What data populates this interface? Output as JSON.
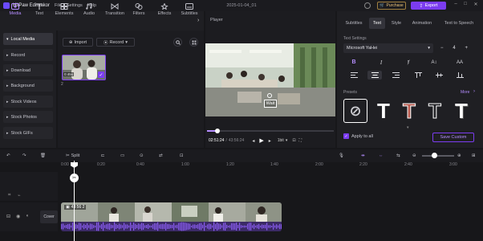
{
  "app": {
    "name": "HitPaw Edimakor",
    "menu": [
      "File",
      "Settings",
      "Help"
    ],
    "project_title": "2025-01-04_01",
    "purchase_label": "Purchase",
    "export_label": "Export"
  },
  "toolbar": {
    "tabs": [
      {
        "label": "Media",
        "icon": "media-icon"
      },
      {
        "label": "Text",
        "icon": "text-icon"
      },
      {
        "label": "Elements",
        "icon": "elements-icon"
      },
      {
        "label": "Audio",
        "icon": "audio-icon"
      },
      {
        "label": "Transition",
        "icon": "transition-icon"
      },
      {
        "label": "Filters",
        "icon": "filters-icon"
      },
      {
        "label": "Effects",
        "icon": "effects-icon"
      },
      {
        "label": "Subtitles",
        "icon": "subtitles-icon"
      }
    ]
  },
  "sidebar": {
    "items": [
      {
        "label": "Local Media"
      },
      {
        "label": "Record"
      },
      {
        "label": "Download"
      },
      {
        "label": "Background"
      },
      {
        "label": "Stock Videos"
      },
      {
        "label": "Stock Photos"
      },
      {
        "label": "Stock GIFs"
      }
    ]
  },
  "media": {
    "import_label": "Import",
    "record_label": "Record",
    "thumb_duration": "0:45s",
    "thumb_caption": "2"
  },
  "player": {
    "label": "Player",
    "overlay_text": "Wait",
    "current_time": "02:51:24",
    "total_time": "43:56:24",
    "quality": "1bit"
  },
  "right_panel": {
    "tabs": [
      "Subtitles",
      "Text",
      "Style",
      "Animation",
      "Text to Speech"
    ],
    "active_tab": "Text",
    "text_settings_label": "Text Settings",
    "font": "Microsoft YaHei",
    "font_size": "4",
    "presets_label": "Presets",
    "more_label": "More",
    "apply_all_label": "Apply to all",
    "save_custom_label": "Save Custom"
  },
  "timeline": {
    "split_label": "Split",
    "ruler_ticks": [
      "0:00",
      "0:20",
      "0:40",
      "1:00",
      "1:20",
      "1:40",
      "2:00",
      "2:20",
      "2:40",
      "3:00"
    ],
    "clip_label": "43:56 2",
    "cover_label": "Cover"
  },
  "colors": {
    "accent": "#7b3cf0",
    "accent_light": "#b48cff",
    "bg": "#17171a",
    "panel": "#1f1f23",
    "purchase": "#e8c27a",
    "waveform": "#8a5cf0"
  }
}
